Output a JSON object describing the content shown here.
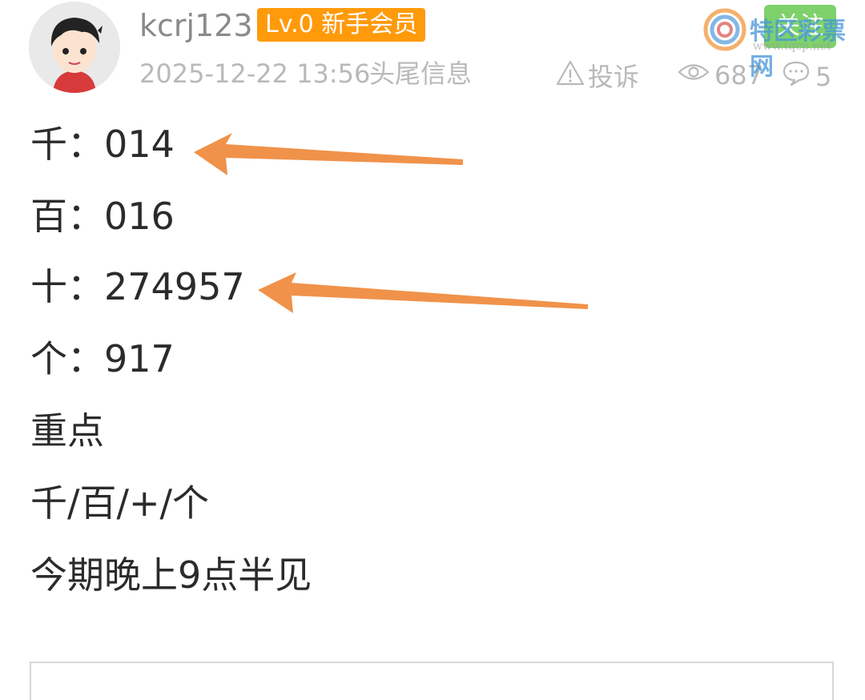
{
  "header": {
    "username": "kcrj123",
    "level_badge": "Lv.0 新手会员",
    "post_time": "2025-12-22 13:56",
    "post_tag": "头尾信息",
    "report_label": "投诉",
    "views": "687",
    "comments": "5",
    "follow_label": "关注"
  },
  "watermark": {
    "site_name": "特区彩票网",
    "url": "www.tqcp.net"
  },
  "post": {
    "lines": [
      "千：014",
      "百：016",
      "十：274957",
      "个：917",
      "重点",
      "千/百/+/个",
      "今期晚上9点半见"
    ]
  },
  "colors": {
    "badge": "#ff9a0b",
    "arrow": "#f0924a",
    "meta_text": "#b9b9b9",
    "follow_button": "#7ed16b"
  },
  "icons": {
    "report": "warning-triangle-icon",
    "views": "eye-icon",
    "comments": "chat-bubble-icon"
  }
}
